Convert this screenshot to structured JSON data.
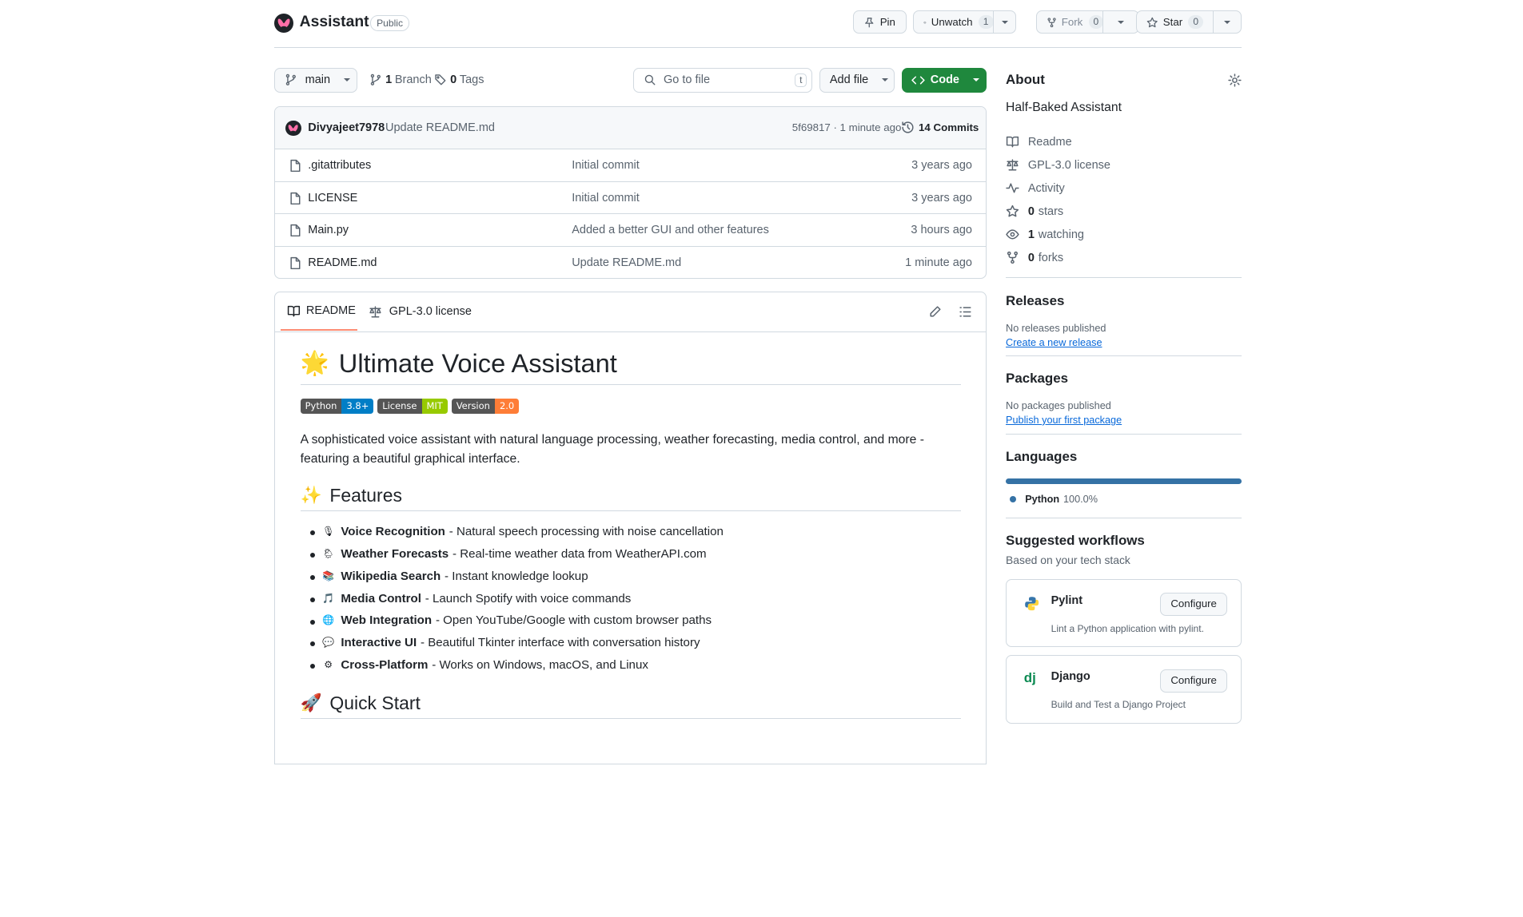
{
  "header": {
    "repo_name": "Assistant",
    "visibility": "Public",
    "pin_label": "Pin",
    "unwatch_label": "Unwatch",
    "watch_count": "1",
    "fork_label": "Fork",
    "fork_count": "0",
    "star_label": "Star",
    "star_count": "0"
  },
  "toolbar": {
    "branch": "main",
    "branches_count": "1",
    "branches_label": "Branch",
    "tags_count": "0",
    "tags_label": "Tags",
    "search_placeholder": "Go to file",
    "search_shortcut": "t",
    "add_file_label": "Add file",
    "code_label": "Code"
  },
  "commit": {
    "author": "Divyajeet7978",
    "message": "Update README.md",
    "hash_time": "5f69817 · 1 minute ago",
    "commits_label": "14 Commits"
  },
  "files": [
    {
      "name": ".gitattributes",
      "message": "Initial commit",
      "time": "3 years ago"
    },
    {
      "name": "LICENSE",
      "message": "Initial commit",
      "time": "3 years ago"
    },
    {
      "name": "Main.py",
      "message": "Added a better GUI and other features",
      "time": "3 hours ago"
    },
    {
      "name": "README.md",
      "message": "Update README.md",
      "time": "1 minute ago"
    }
  ],
  "readme": {
    "tab_readme": "README",
    "tab_license": "GPL-3.0 license",
    "title_emoji": "🌟",
    "title": "Ultimate Voice Assistant",
    "badges": [
      {
        "left": "Python",
        "right": "3.8+",
        "color": "#007ec6"
      },
      {
        "left": "License",
        "right": "MIT",
        "color": "#97ca00"
      },
      {
        "left": "Version",
        "right": "2.0",
        "color": "#fe7d37"
      }
    ],
    "description": "A sophisticated voice assistant with natural language processing, weather forecasting, media control, and more - featuring a beautiful graphical interface.",
    "features_emoji": "✨",
    "features_heading": "Features",
    "features": [
      {
        "icon": "🎙",
        "title": "Voice Recognition",
        "text": "- Natural speech processing with noise cancellation"
      },
      {
        "icon": "🌦",
        "title": "Weather Forecasts",
        "text": "- Real-time weather data from WeatherAPI.com"
      },
      {
        "icon": "📚",
        "title": "Wikipedia Search",
        "text": "- Instant knowledge lookup"
      },
      {
        "icon": "🎵",
        "title": "Media Control",
        "text": "- Launch Spotify with voice commands"
      },
      {
        "icon": "🌐",
        "title": "Web Integration",
        "text": "- Open YouTube/Google with custom browser paths"
      },
      {
        "icon": "💬",
        "title": "Interactive UI",
        "text": "- Beautiful Tkinter interface with conversation history"
      },
      {
        "icon": "⚙",
        "title": "Cross-Platform",
        "text": "- Works on Windows, macOS, and Linux"
      }
    ],
    "quickstart_emoji": "🚀",
    "quickstart_heading": "Quick Start"
  },
  "about": {
    "heading": "About",
    "description": "Half-Baked Assistant",
    "readme": "Readme",
    "license": "GPL-3.0 license",
    "activity": "Activity",
    "stars_count": "0",
    "stars_label": "stars",
    "watching_count": "1",
    "watching_label": "watching",
    "forks_count": "0",
    "forks_label": "forks"
  },
  "releases": {
    "heading": "Releases",
    "empty": "No releases published",
    "link": "Create a new release"
  },
  "packages": {
    "heading": "Packages",
    "empty": "No packages published",
    "link": "Publish your first package"
  },
  "languages": {
    "heading": "Languages",
    "name": "Python",
    "percent": "100.0%",
    "share": 1.0,
    "color": "#3572A5"
  },
  "workflows": {
    "heading": "Suggested workflows",
    "subheading": "Based on your tech stack",
    "items": [
      {
        "name": "Pylint",
        "description": "Lint a Python application with pylint.",
        "button": "Configure"
      },
      {
        "name": "Django",
        "description": "Build and Test a Django Project",
        "button": "Configure"
      }
    ]
  }
}
